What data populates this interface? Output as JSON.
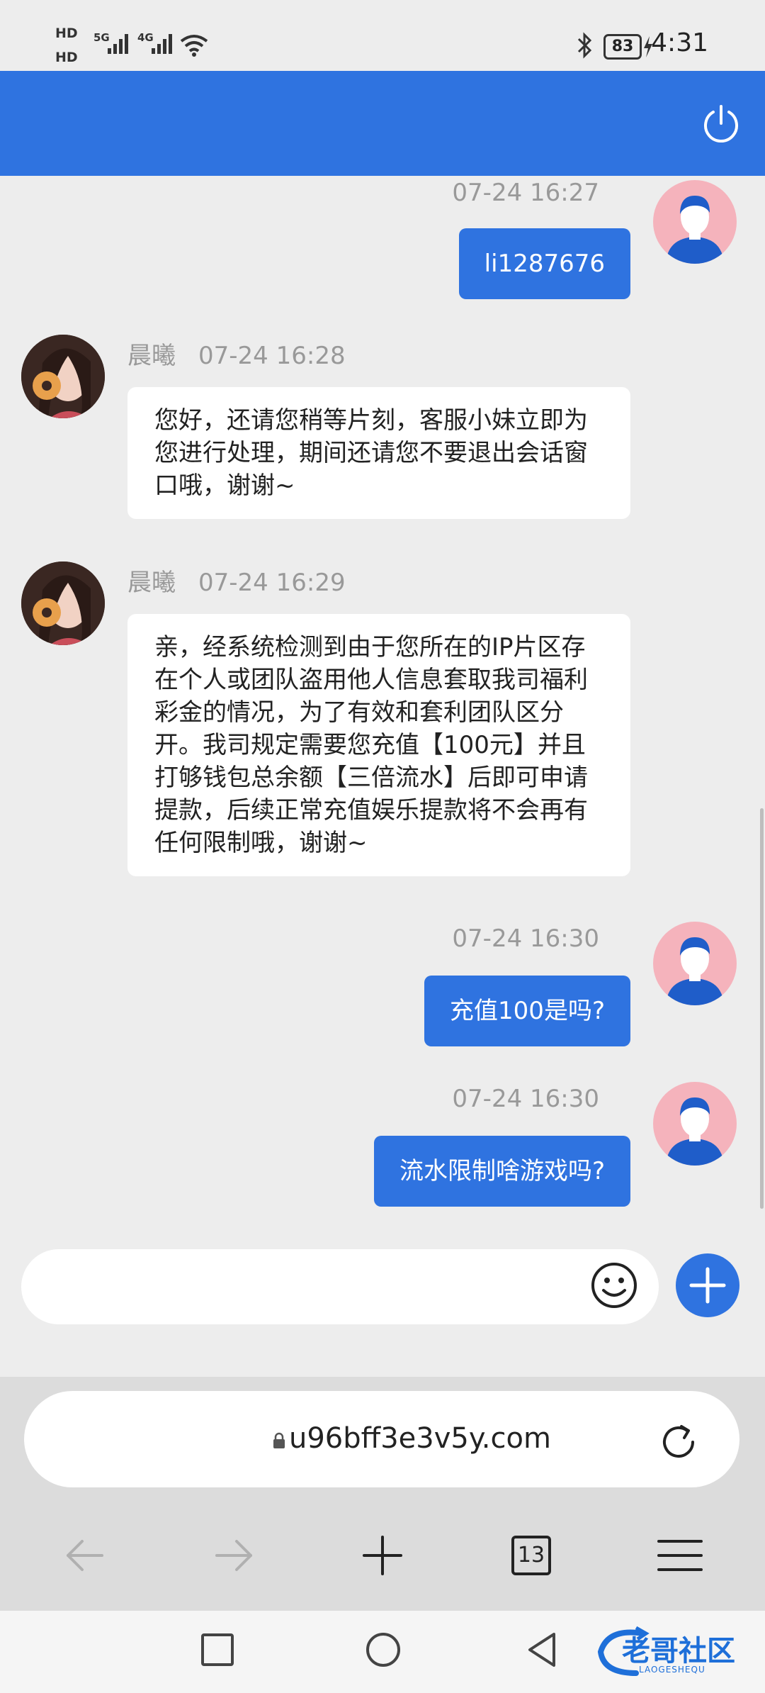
{
  "status_bar": {
    "hd1": "HD",
    "hd2": "HD",
    "net1": "5G",
    "net2": "4G",
    "battery": "83",
    "time": "4:31"
  },
  "messages": {
    "m1": {
      "timestamp": "07-24 16:27",
      "text": "li1287676"
    },
    "m2": {
      "sender": "晨曦",
      "timestamp": "07-24 16:28",
      "text": "您好，还请您稍等片刻，客服小妹立即为您进行处理，期间还请您不要退出会话窗口哦，谢谢~"
    },
    "m3": {
      "sender": "晨曦",
      "timestamp": "07-24 16:29",
      "text": "亲，经系统检测到由于您所在的IP片区存在个人或团队盗用他人信息套取我司福利彩金的情况，为了有效和套利团队区分开。我司规定需要您充值【100元】并且打够钱包总余额【三倍流水】后即可申请提款，后续正常充值娱乐提款将不会再有任何限制哦，谢谢~"
    },
    "m4": {
      "timestamp": "07-24 16:30",
      "text": "充值100是吗?"
    },
    "m5": {
      "timestamp": "07-24 16:30",
      "text": "流水限制啥游戏吗?"
    }
  },
  "composer": {
    "placeholder": ""
  },
  "browser": {
    "url": "u96bff3e3v5y.com",
    "tab_count": "13"
  },
  "watermark": {
    "title": "老哥社区",
    "subtitle": "LAOGESHEQU"
  },
  "colors": {
    "accent": "#2f73e0",
    "background": "#ededed"
  },
  "icons": [
    "power-icon",
    "emoji-icon",
    "plus-icon",
    "lock-icon",
    "reload-icon",
    "back-arrow-icon",
    "forward-arrow-icon",
    "new-tab-icon",
    "menu-icon",
    "recents-icon",
    "home-icon",
    "back-triangle-icon"
  ]
}
